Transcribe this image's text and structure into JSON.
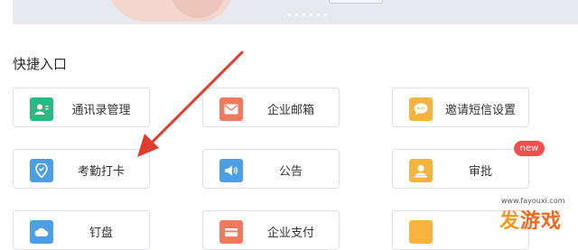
{
  "section_title": "快捷入口",
  "tiles": [
    {
      "label": "通讯录管理",
      "icon": "contacts-icon",
      "color": "#2cb783"
    },
    {
      "label": "企业邮箱",
      "icon": "mail-icon",
      "color": "#f07a5d"
    },
    {
      "label": "邀请短信设置",
      "icon": "sms-icon",
      "color": "#f6b43f"
    },
    {
      "label": "考勤打卡",
      "icon": "location-check-icon",
      "color": "#4c9fe3"
    },
    {
      "label": "公告",
      "icon": "megaphone-icon",
      "color": "#4c9fe3"
    },
    {
      "label": "审批",
      "icon": "approval-icon",
      "color": "#f6b43f",
      "badge": "new"
    },
    {
      "label": "钉盘",
      "icon": "cloud-icon",
      "color": "#4c9fe3"
    },
    {
      "label": "企业支付",
      "icon": "payment-icon",
      "color": "#f07a5d"
    },
    {
      "label": "",
      "icon": "stop-approval-icon",
      "color": "#f6b43f"
    }
  ],
  "watermark": {
    "brand_fa": "发",
    "brand_rest": "游戏",
    "url": "www.fayouxi.com"
  },
  "colors": {
    "arrow": "#e23b2e",
    "badge": "#f24e4e",
    "border": "#dcdfe4"
  }
}
